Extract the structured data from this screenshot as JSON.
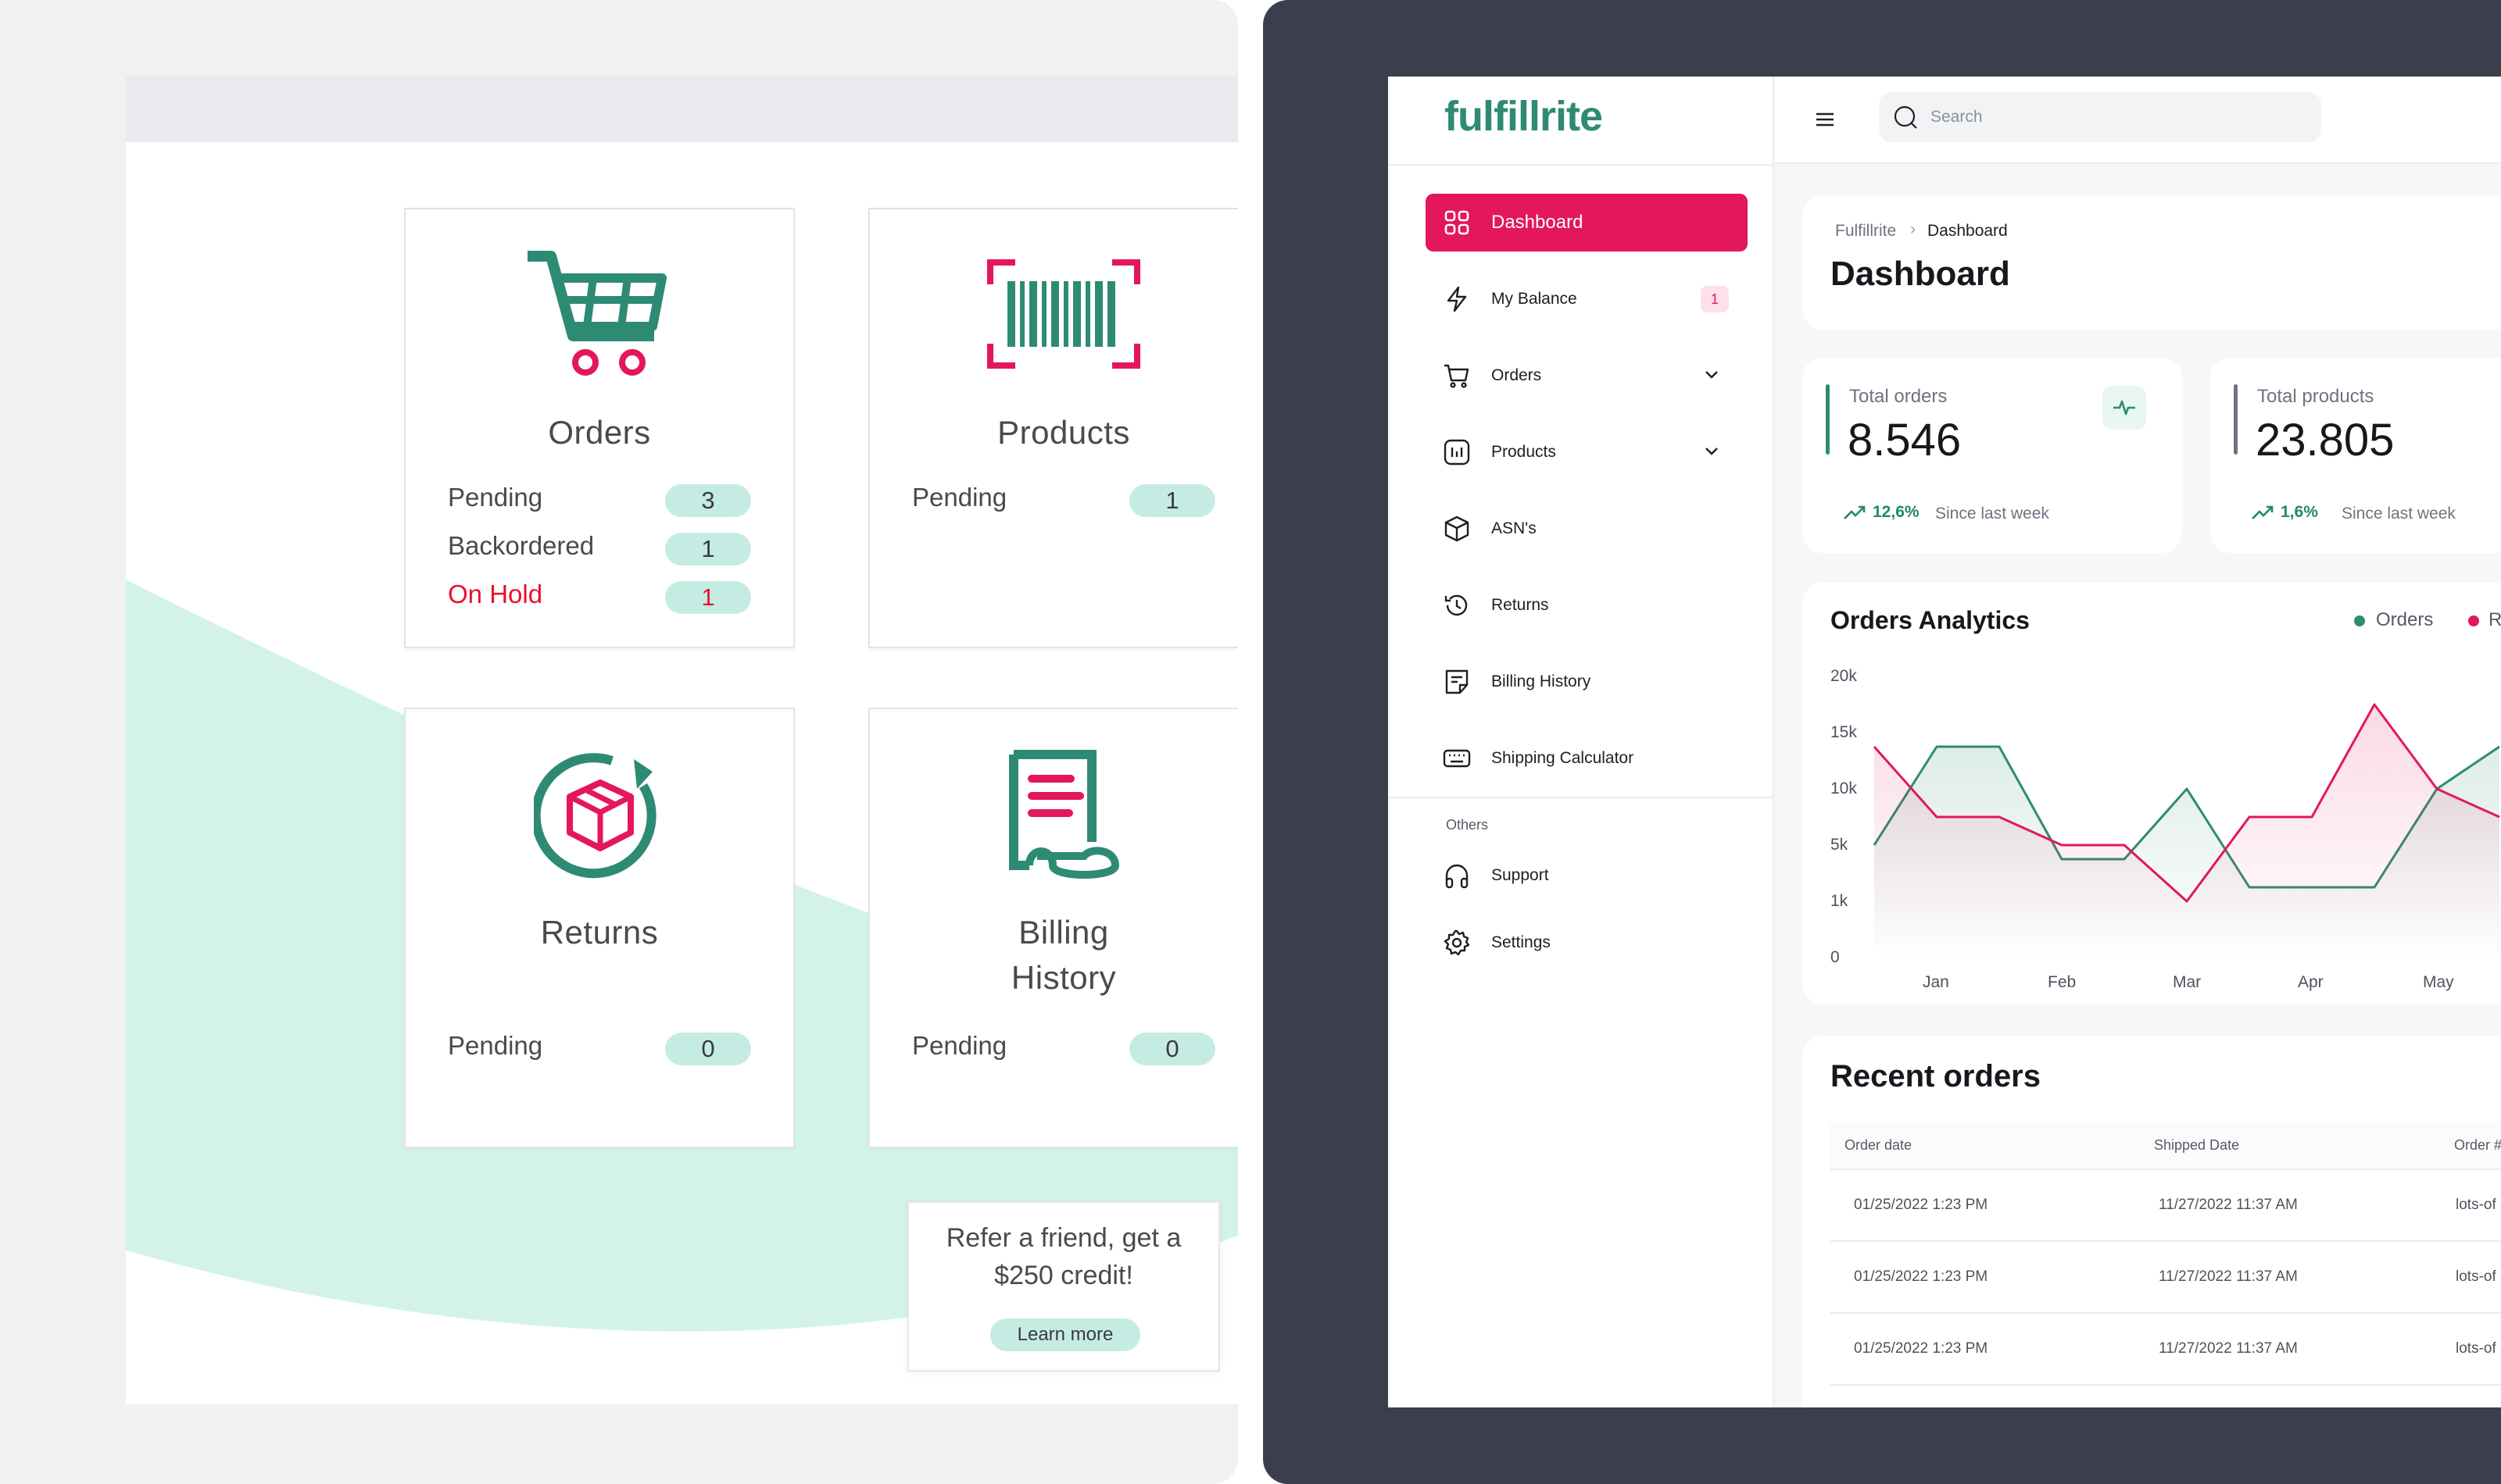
{
  "old_ui": {
    "cards": {
      "orders": {
        "title": "Orders",
        "rows": [
          {
            "label": "Pending",
            "value": "3"
          },
          {
            "label": "Backordered",
            "value": "1"
          },
          {
            "label": "On Hold",
            "value": "1"
          }
        ]
      },
      "products": {
        "title": "Products",
        "rows": [
          {
            "label": "Pending",
            "value": "1"
          }
        ]
      },
      "returns": {
        "title": "Returns",
        "rows": [
          {
            "label": "Pending",
            "value": "0"
          }
        ]
      },
      "billing": {
        "title_line1": "Billing",
        "title_line2": "History",
        "rows": [
          {
            "label": "Pending",
            "value": "0"
          }
        ]
      }
    },
    "referral": {
      "text_line1": "Refer a friend, get a",
      "text_line2": "$250 credit!",
      "button": "Learn more"
    },
    "colors": {
      "green": "#2e8b73",
      "pink": "#e3175a",
      "mint": "#c5ece3",
      "red": "#e8102f"
    }
  },
  "new_ui": {
    "logo": "fulfillrite",
    "search": {
      "placeholder": "Search"
    },
    "sidebar": {
      "items": [
        {
          "label": "Dashboard",
          "icon": "grid-icon",
          "active": true
        },
        {
          "label": "My Balance",
          "icon": "lightning-icon",
          "badge": "1"
        },
        {
          "label": "Orders",
          "icon": "cart-icon",
          "expandable": true
        },
        {
          "label": "Products",
          "icon": "chart-box-icon",
          "expandable": true
        },
        {
          "label": "ASN's",
          "icon": "box-icon"
        },
        {
          "label": "Returns",
          "icon": "history-icon"
        },
        {
          "label": "Billing History",
          "icon": "receipt-icon"
        },
        {
          "label": "Shipping Calculator",
          "icon": "keyboard-icon"
        }
      ],
      "others_heading": "Others",
      "others": [
        {
          "label": "Support",
          "icon": "headphones-icon"
        },
        {
          "label": "Settings",
          "icon": "gear-icon"
        }
      ]
    },
    "breadcrumb": {
      "root": "Fulfillrite",
      "current": "Dashboard"
    },
    "page_title": "Dashboard",
    "stats": [
      {
        "label": "Total orders",
        "value": "8.546",
        "delta": "12,6%",
        "since": "Since last week"
      },
      {
        "label": "Total products",
        "value": "23.805",
        "delta": "1,6%",
        "since": "Since last week"
      }
    ],
    "analytics": {
      "title": "Orders Analytics",
      "legend": [
        "Orders",
        "R"
      ]
    },
    "recent_orders": {
      "title": "Recent orders",
      "columns": [
        "Order date",
        "Shipped Date",
        "Order #"
      ],
      "rows": [
        [
          "01/25/2022 1:23 PM",
          "11/27/2022 11:37 AM",
          "lots-of"
        ],
        [
          "01/25/2022 1:23 PM",
          "11/27/2022 11:37 AM",
          "lots-of"
        ],
        [
          "01/25/2022 1:23 PM",
          "11/27/2022 11:37 AM",
          "lots-of"
        ]
      ]
    },
    "colors": {
      "accent": "#e3175a",
      "green": "#2e8b73",
      "dark_bg": "#3a3f4b"
    }
  },
  "chart_data": {
    "type": "line",
    "title": "Orders Analytics",
    "categories": [
      "Jan",
      "Feb",
      "Mar",
      "Apr",
      "May"
    ],
    "y_ticks": [
      "20k",
      "15k",
      "10k",
      "5k",
      "1k",
      "0"
    ],
    "x": [
      0,
      0.5,
      1,
      1.5,
      2,
      2.5,
      3,
      3.5,
      4,
      4.5,
      5
    ],
    "series": [
      {
        "name": "Orders",
        "color": "#2e8b73",
        "values": [
          8,
          15,
          15,
          7,
          7,
          12,
          5,
          5,
          5,
          12,
          15
        ]
      },
      {
        "name": "R",
        "color": "#e3175a",
        "values": [
          15,
          10,
          10,
          8,
          8,
          4,
          10,
          10,
          18,
          12,
          10
        ]
      }
    ],
    "ylim": [
      0,
      20
    ],
    "legend": "top-right",
    "grid": false
  }
}
